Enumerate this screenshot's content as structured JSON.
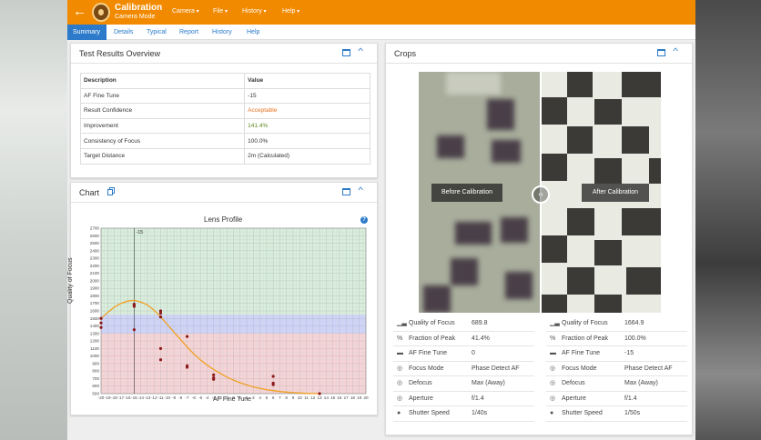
{
  "app": {
    "title": "Calibration",
    "subtitle": "Camera Mode"
  },
  "menus": [
    "Camera",
    "File",
    "History",
    "Help"
  ],
  "tabs": [
    "Summary",
    "Details",
    "Typical",
    "Report",
    "History",
    "Help"
  ],
  "results": {
    "title": "Test Results Overview",
    "headers": [
      "Description",
      "Value"
    ],
    "rows": [
      [
        "AF Fine Tune",
        "-15"
      ],
      [
        "Result Confidence",
        "Acceptable"
      ],
      [
        "Improvement",
        "141.4%"
      ],
      [
        "Consistency of Focus",
        "100.0%"
      ],
      [
        "Target Distance",
        "2m (Calculated)"
      ]
    ]
  },
  "chart_panel": {
    "title": "Chart"
  },
  "chart_data": {
    "type": "scatter",
    "title": "Lens Profile",
    "xlabel": "AF Fine Tune",
    "ylabel": "Quality of Focus",
    "xlim": [
      -20,
      20
    ],
    "ylim": [
      500,
      2700
    ],
    "yticks": [
      500,
      600,
      700,
      800,
      900,
      1000,
      1100,
      1200,
      1300,
      1400,
      1500,
      1600,
      1700,
      1800,
      1900,
      2000,
      2100,
      2200,
      2300,
      2400,
      2500,
      2600,
      2700
    ],
    "xticks": [
      -20,
      -19,
      -18,
      -17,
      -16,
      -15,
      -14,
      -13,
      -12,
      -11,
      -10,
      -9,
      -8,
      -7,
      -6,
      -5,
      -4,
      -3,
      -2,
      -1,
      0,
      1,
      2,
      3,
      4,
      5,
      6,
      7,
      8,
      9,
      10,
      11,
      12,
      13,
      14,
      15,
      16,
      17,
      18,
      19,
      20
    ],
    "marker_label": "-15",
    "marker_x": -15,
    "bands": [
      {
        "from": 500,
        "to": 1300,
        "color": "#f8d3d6"
      },
      {
        "from": 1300,
        "to": 1550,
        "color": "#cdd3fb"
      },
      {
        "from": 1550,
        "to": 2700,
        "color": "#d8efdc"
      }
    ],
    "points": [
      [
        -20,
        1500
      ],
      [
        -20,
        1440
      ],
      [
        -20,
        1380
      ],
      [
        -15,
        1680
      ],
      [
        -15,
        1660
      ],
      [
        -15,
        1690
      ],
      [
        -15,
        1350
      ],
      [
        -11,
        1600
      ],
      [
        -11,
        1570
      ],
      [
        -11,
        1520
      ],
      [
        -11,
        1100
      ],
      [
        -11,
        950
      ],
      [
        -7,
        1260
      ],
      [
        -7,
        870
      ],
      [
        -7,
        850
      ],
      [
        -3,
        750
      ],
      [
        -3,
        710
      ],
      [
        -3,
        690
      ],
      [
        6,
        730
      ],
      [
        6,
        640
      ],
      [
        6,
        620
      ],
      [
        13,
        500
      ]
    ],
    "curve": [
      [
        -20,
        1500
      ],
      [
        -19,
        1580
      ],
      [
        -18,
        1650
      ],
      [
        -17,
        1700
      ],
      [
        -16,
        1730
      ],
      [
        -15,
        1740
      ],
      [
        -14,
        1720
      ],
      [
        -13,
        1680
      ],
      [
        -12,
        1610
      ],
      [
        -11,
        1520
      ],
      [
        -10,
        1420
      ],
      [
        -9,
        1320
      ],
      [
        -8,
        1220
      ],
      [
        -7,
        1120
      ],
      [
        -6,
        1030
      ],
      [
        -5,
        950
      ],
      [
        -4,
        880
      ],
      [
        -3,
        820
      ],
      [
        -2,
        770
      ],
      [
        -1,
        720
      ],
      [
        0,
        680
      ],
      [
        1,
        645
      ],
      [
        2,
        615
      ],
      [
        3,
        590
      ],
      [
        4,
        570
      ],
      [
        5,
        553
      ],
      [
        6,
        540
      ],
      [
        7,
        528
      ],
      [
        8,
        520
      ],
      [
        9,
        513
      ],
      [
        10,
        508
      ],
      [
        11,
        504
      ],
      [
        12,
        501
      ],
      [
        13,
        500
      ]
    ],
    "series_color": "#f0a020",
    "point_color": "#8b1a1a"
  },
  "crops": {
    "title": "Crops",
    "before_label": "Before Calibration",
    "after_label": "After Calibration",
    "before": [
      [
        "Quality of Focus",
        "689.8"
      ],
      [
        "Fraction of Peak",
        "41.4%"
      ],
      [
        "AF Fine Tune",
        "0"
      ],
      [
        "Focus Mode",
        "Phase Detect AF"
      ],
      [
        "Defocus",
        "Max (Away)"
      ],
      [
        "Aperture",
        "f/1.4"
      ],
      [
        "Shutter Speed",
        "1/40s"
      ]
    ],
    "after": [
      [
        "Quality of Focus",
        "1664.9"
      ],
      [
        "Fraction of Peak",
        "100.0%"
      ],
      [
        "AF Fine Tune",
        "-15"
      ],
      [
        "Focus Mode",
        "Phase Detect AF"
      ],
      [
        "Defocus",
        "Max (Away)"
      ],
      [
        "Aperture",
        "f/1.4"
      ],
      [
        "Shutter Speed",
        "1/50s"
      ]
    ],
    "icons": [
      "bar-chart-icon",
      "percent-icon",
      "slider-icon",
      "target-icon",
      "target-icon",
      "aperture-icon",
      "shutter-icon"
    ]
  },
  "colors": {
    "accent": "#f28a00",
    "link": "#2c7ac9",
    "acceptable": "#e4701e",
    "improvement": "#5b8a1f"
  }
}
